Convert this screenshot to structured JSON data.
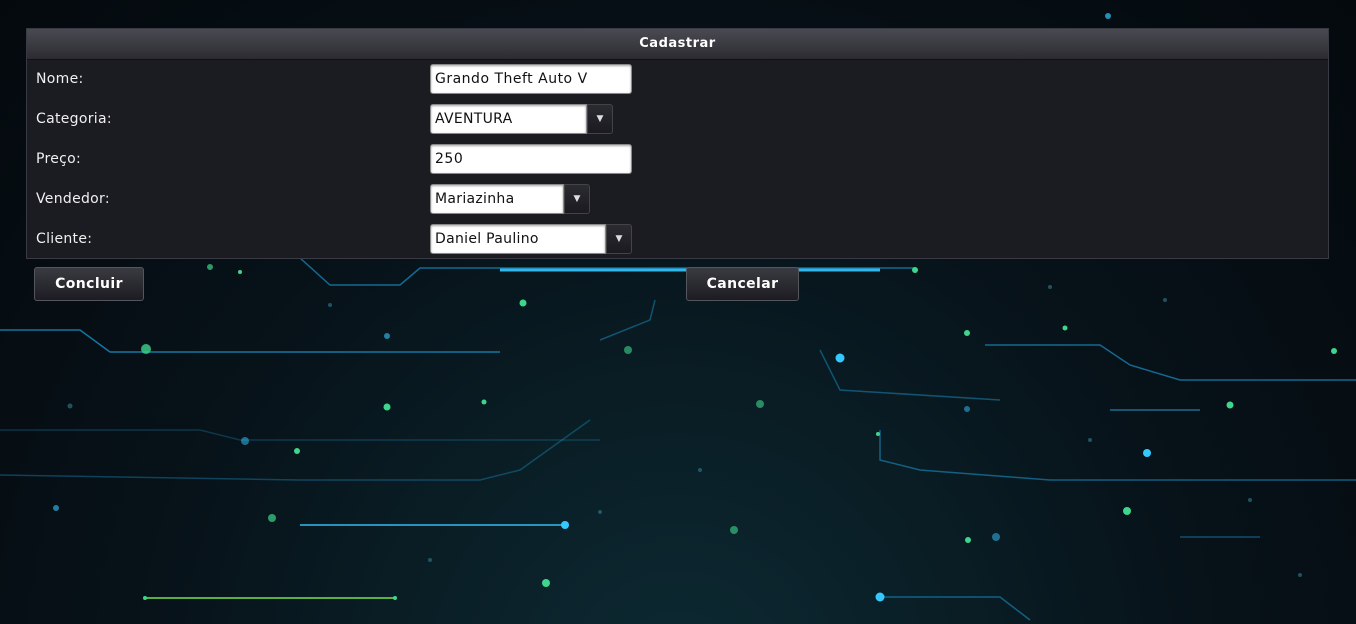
{
  "form": {
    "title": "Cadastrar",
    "fields": {
      "nome": {
        "label": "Nome:",
        "value": "Grando Theft Auto V"
      },
      "categoria": {
        "label": "Categoria:",
        "value": "AVENTURA"
      },
      "preco": {
        "label": "Preço:",
        "value": "250"
      },
      "vendedor": {
        "label": "Vendedor:",
        "value": "Mariazinha"
      },
      "cliente": {
        "label": "Cliente:",
        "value": "Daniel Paulino"
      }
    }
  },
  "actions": {
    "concluir_label": "Concluir",
    "cancelar_label": "Cancelar"
  },
  "icons": {
    "dropdown": "chevron-down-icon"
  },
  "colors": {
    "panel_bg": "#1b1b22",
    "circuit_blue": "#1fb6ff",
    "circuit_green": "#3dd68c"
  }
}
